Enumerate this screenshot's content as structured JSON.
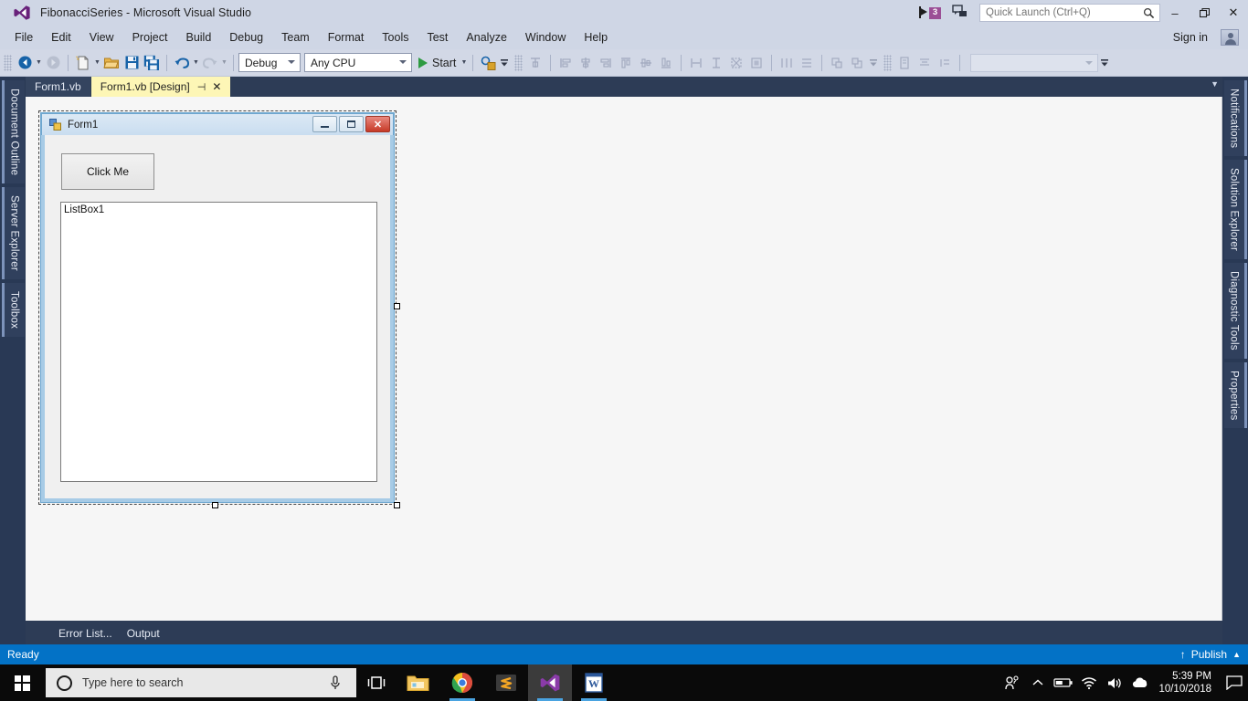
{
  "window": {
    "title": "FibonacciSeries - Microsoft Visual Studio",
    "logo_icon": "visual-studio-logo-icon",
    "minimize_label": "–",
    "restore_label": "❐",
    "close_label": "✕"
  },
  "titlebar": {
    "feedback_flag_icon": "feedback-flag-icon",
    "notification_count": "3",
    "send_feedback_icon": "send-feedback-icon",
    "quick_launch_placeholder": "Quick Launch (Ctrl+Q)",
    "quick_launch_value": "",
    "search_icon": "search-icon"
  },
  "menubar": {
    "items": [
      {
        "label": "File"
      },
      {
        "label": "Edit"
      },
      {
        "label": "View"
      },
      {
        "label": "Project"
      },
      {
        "label": "Build"
      },
      {
        "label": "Debug"
      },
      {
        "label": "Team"
      },
      {
        "label": "Format"
      },
      {
        "label": "Tools"
      },
      {
        "label": "Test"
      },
      {
        "label": "Analyze"
      },
      {
        "label": "Window"
      },
      {
        "label": "Help"
      }
    ],
    "sign_in_label": "Sign in",
    "account_icon": "account-icon"
  },
  "toolbar": {
    "navigate_back_icon": "navigate-back-icon",
    "navigate_forward_icon": "navigate-forward-icon",
    "new_project_icon": "new-project-icon",
    "open_file_icon": "open-file-icon",
    "save_icon": "save-icon",
    "save_all_icon": "save-all-icon",
    "undo_icon": "undo-icon",
    "redo_icon": "redo-icon",
    "configuration": "Debug",
    "platform": "Any CPU",
    "start_label": "Start",
    "start_icon": "play-icon",
    "find_icon": "find-in-files-icon",
    "layout_icons": [
      "align-to-grid-icon",
      "align-lefts-icon",
      "align-centers-icon",
      "align-rights-icon",
      "align-tops-icon",
      "align-middles-icon",
      "align-bottoms-icon",
      "make-same-width-icon",
      "make-same-height-icon",
      "make-same-size-icon",
      "size-to-grid-icon",
      "horizontal-spacing-icon",
      "vertical-spacing-icon",
      "bring-to-front-icon",
      "send-to-back-icon",
      "tab-order-icon",
      "center-horizontally-icon",
      "center-vertically-icon"
    ],
    "overflow_icon": "toolbar-overflow-icon",
    "font_combo_value": ""
  },
  "left_dock": {
    "items": [
      {
        "label": "Document Outline"
      },
      {
        "label": "Server Explorer"
      },
      {
        "label": "Toolbox"
      }
    ]
  },
  "right_dock": {
    "items": [
      {
        "label": "Notifications"
      },
      {
        "label": "Solution Explorer"
      },
      {
        "label": "Diagnostic Tools"
      },
      {
        "label": "Properties"
      }
    ]
  },
  "document_tabs": {
    "items": [
      {
        "label": "Form1.vb",
        "active": false
      },
      {
        "label": "Form1.vb [Design]",
        "active": true
      }
    ],
    "pin_icon": "pin-icon",
    "close_icon": "close-icon",
    "overflow_icon": "tab-list-chevron-icon"
  },
  "designer": {
    "form": {
      "title": "Form1",
      "icon": "form-designer-icon",
      "minimize_label": "",
      "maximize_label": "",
      "close_label": "✕",
      "button": {
        "text": "Click Me"
      },
      "listbox": {
        "text": "ListBox1"
      }
    }
  },
  "bottom_tabs": {
    "items": [
      {
        "label": "Error List..."
      },
      {
        "label": "Output"
      }
    ]
  },
  "statusbar": {
    "text": "Ready",
    "publish_label": "Publish",
    "publish_up_icon": "arrow-up-icon",
    "publish_caret_icon": "caret-up-icon"
  },
  "taskbar": {
    "start_icon": "windows-start-icon",
    "search_placeholder": "Type here to search",
    "search_circle_icon": "cortana-circle-icon",
    "mic_icon": "microphone-icon",
    "task_view_icon": "task-view-icon",
    "apps": [
      {
        "name": "file-explorer",
        "active": false,
        "running": false
      },
      {
        "name": "google-chrome",
        "active": false,
        "running": true
      },
      {
        "name": "sublime-text",
        "active": false,
        "running": false
      },
      {
        "name": "visual-studio",
        "active": true,
        "running": true
      },
      {
        "name": "microsoft-word",
        "active": false,
        "running": true
      }
    ],
    "tray": {
      "people_icon": "people-icon",
      "show_hidden_icon": "show-hidden-icons-chevron",
      "battery_icon": "battery-icon",
      "network_icon": "wifi-icon",
      "volume_icon": "volume-icon",
      "onedrive_icon": "onedrive-icon",
      "time": "5:39 PM",
      "date": "10/10/2018",
      "action_center_icon": "action-center-icon"
    }
  },
  "colors": {
    "titlebar_bg": "#cfd6e5",
    "toolbar_bg": "#d2d8e6",
    "shell_dark": "#2d3c56",
    "status_blue": "#0372c6",
    "active_tab_yellow": "#fdf6b6",
    "accent_purple": "#9b4f96",
    "taskbar_black": "#0a0a0a"
  }
}
